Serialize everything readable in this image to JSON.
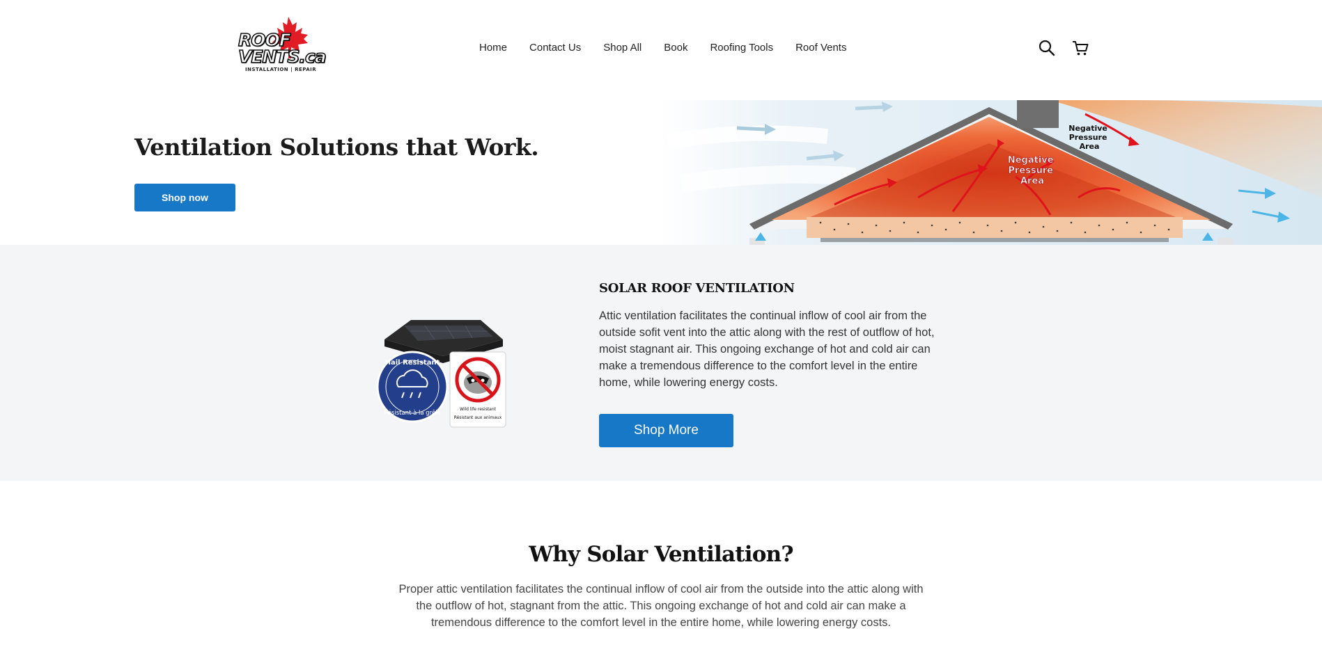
{
  "header": {
    "logo_main": "ROOF VENTS.ca",
    "logo_sub": "INSTALLATION | REPAIR",
    "nav": [
      "Home",
      "Contact Us",
      "Shop All",
      "Book",
      "Roofing Tools",
      "Roof Vents"
    ],
    "icons": [
      "search-icon",
      "cart-icon"
    ]
  },
  "hero": {
    "title": "Ventilation Solutions that Work.",
    "button_label": "Shop now",
    "diagram_labels": {
      "inner": [
        "Negative",
        "Pressure",
        "Area"
      ],
      "outer": [
        "Negative",
        "Pressure",
        "Area"
      ]
    }
  },
  "solar": {
    "heading": "SOLAR ROOF VENTILATION",
    "text": "Attic ventilation facilitates the continual inflow of cool air from the outside sofit vent into the attic along with the rest of outflow of hot, moist stagnant air. This ongoing exchange of hot and cold air can make a tremendous difference to the comfort level in the entire home, while lowering energy costs.",
    "button_label": "Shop More",
    "badges": {
      "hail_top": "Hail Resistant",
      "hail_bottom": "Résistant à la grêle",
      "wildlife_1": "Wild life resistant",
      "wildlife_2": "Résistant aux animaux"
    }
  },
  "why": {
    "title": "Why Solar Ventilation?",
    "text": "Proper attic ventilation facilitates the continual inflow of cool air from the outside into the attic along with the outflow of hot, stagnant from the attic. This ongoing exchange of hot and cold air can make a tremendous difference to the comfort level in the entire home, while lowering energy costs."
  },
  "colors": {
    "accent": "#1878c8",
    "section_bg": "#f4f5f7"
  }
}
